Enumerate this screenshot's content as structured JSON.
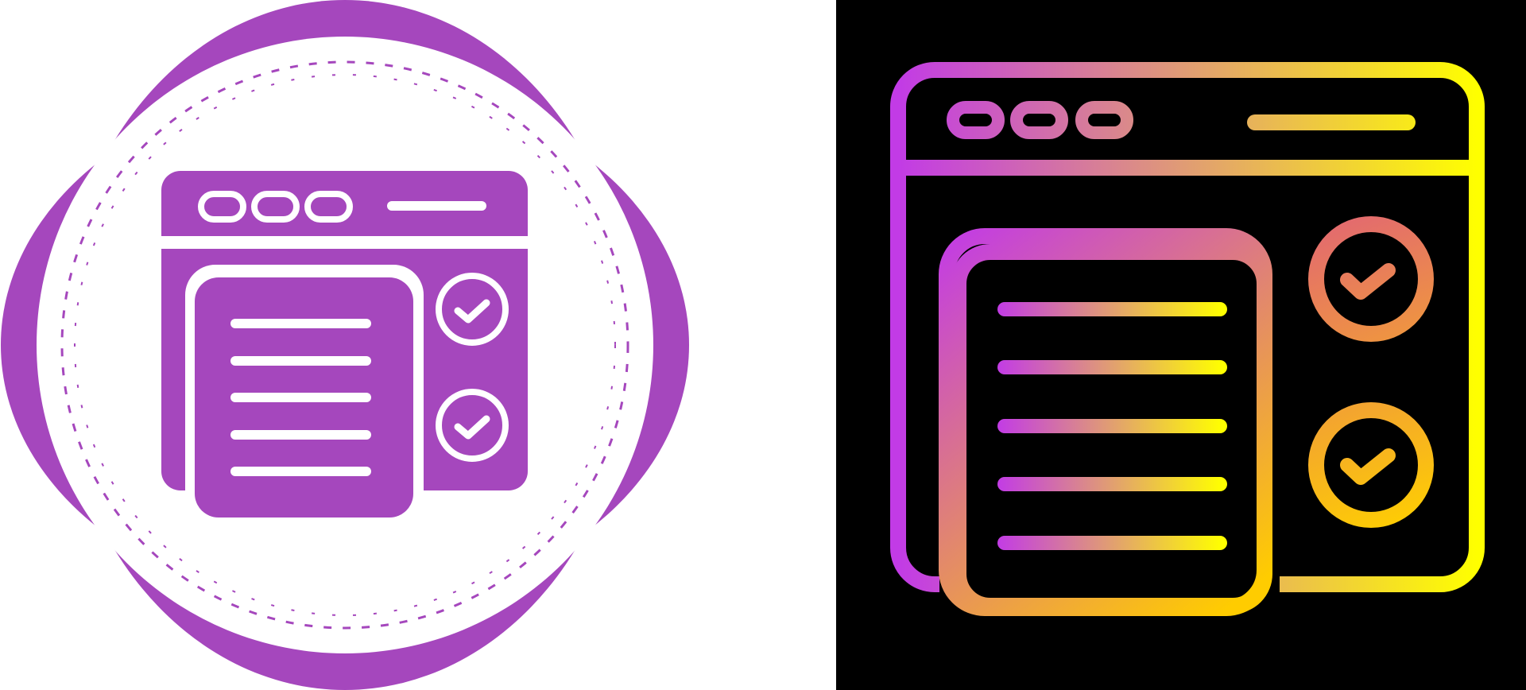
{
  "colors": {
    "glyph_fill": "#a547bd",
    "gradient_start": "#c23be6",
    "gradient_end": "#ffff00",
    "left_background": "#ffffff",
    "right_background": "#000000"
  },
  "icons": {
    "left": "browser-document-checklist-glyph-badge-icon",
    "right": "browser-document-checklist-gradient-outline-icon"
  },
  "window": {
    "dot_count": 3,
    "text_line_count": 5,
    "check_count": 2
  }
}
